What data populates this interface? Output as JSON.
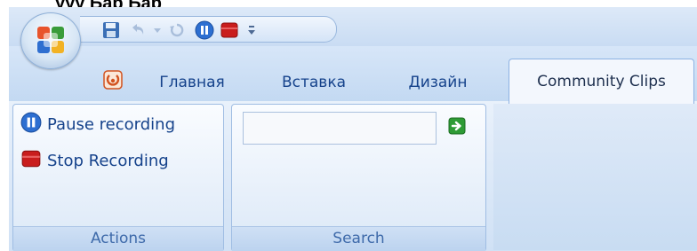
{
  "page_title": "ууу  Бар  Бар",
  "quick_access": {
    "items": [
      {
        "icon": "save-icon"
      },
      {
        "icon": "undo-icon"
      },
      {
        "icon": "dropdown-arrow-icon"
      },
      {
        "icon": "redo-icon"
      },
      {
        "icon": "pause-icon"
      },
      {
        "icon": "stop-record-icon"
      },
      {
        "icon": "customize-qat-icon"
      }
    ]
  },
  "tabs": [
    {
      "label": "Главная",
      "active": false
    },
    {
      "label": "Вставка",
      "active": false
    },
    {
      "label": "Дизайн",
      "active": false
    },
    {
      "label": "Community Clips",
      "active": true
    }
  ],
  "groups": {
    "actions": {
      "label": "Actions",
      "pause_label": "Pause recording",
      "stop_label": "Stop Recording"
    },
    "search": {
      "label": "Search",
      "value": "",
      "placeholder": ""
    }
  },
  "colors": {
    "tab_text": "#15428b",
    "ribbon_bg": "#dbe8f7",
    "group_border": "#9fbde3",
    "pause_blue": "#2d6fd1",
    "stop_red": "#c91d1d",
    "go_green": "#2e9b35"
  }
}
